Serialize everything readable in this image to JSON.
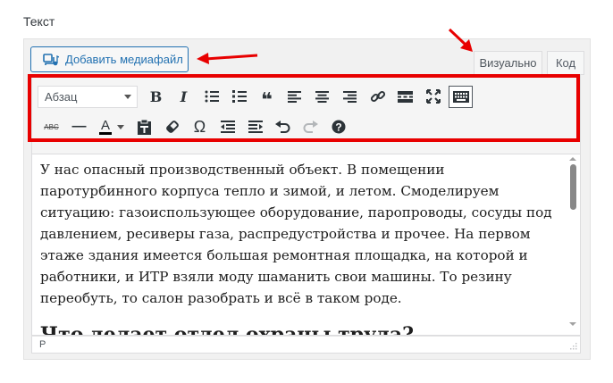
{
  "field": {
    "label": "Текст"
  },
  "media_button": {
    "label": "Добавить медиафайл",
    "icon": "media-icon"
  },
  "tabs": [
    {
      "label": "Визуально",
      "active": true
    },
    {
      "label": "Код",
      "active": false
    }
  ],
  "toolbar": {
    "format_select": {
      "selected": "Абзац"
    },
    "row1": [
      "bold",
      "italic",
      "bullet-list",
      "numbered-list",
      "blockquote",
      "align-left",
      "align-center",
      "align-right",
      "link",
      "read-more",
      "fullscreen",
      "toolbar-toggle"
    ],
    "row2": [
      "strikethrough",
      "horizontal-line",
      "text-color",
      "paste-as-text",
      "clear-formatting",
      "special-character",
      "outdent",
      "indent",
      "undo",
      "redo",
      "help"
    ],
    "bold_glyph": "B",
    "italic_glyph": "I",
    "blockquote_glyph": "❝",
    "strike_glyph": "ABC",
    "hr_glyph": "—",
    "textcolor_glyph": "A",
    "omega_glyph": "Ω"
  },
  "content": {
    "paragraph": "У нас опасный производственный объект. В помещении паротурбинного корпуса тепло и зимой, и летом. Смоделируем ситуацию: газоиспользующее оборудование, паропроводы, сосуды под давлением, ресиверы газа, распредустройства и прочее. На первом этаже здания имеется большая ремонтная площадка, на которой и работники, и ИТР взяли моду шаманить свои машины. То резину переобуть, то салон разобрать и всё в таком роде.",
    "heading": "Что делает отдел охраны труда?"
  },
  "statusbar": {
    "path": "P"
  },
  "colors": {
    "accent": "#2271b1",
    "highlight": "#e80000"
  }
}
